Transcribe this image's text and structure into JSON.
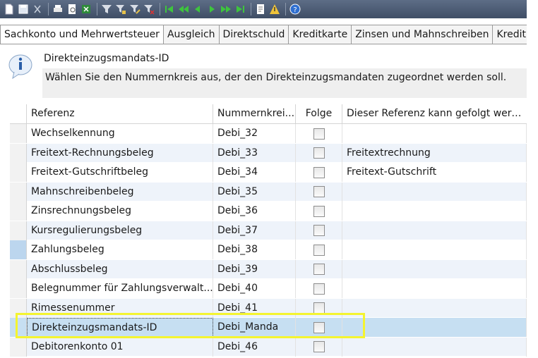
{
  "toolbar": {
    "icons": [
      "new-doc-icon",
      "save-icon",
      "cut-icon",
      "print-icon",
      "preview-icon",
      "export-icon",
      "filter-icon",
      "filter-add-icon",
      "filter-edit-icon",
      "filter-remove-icon",
      "first-icon",
      "prev-page-icon",
      "prev-icon",
      "next-icon",
      "next-page-icon",
      "last-icon",
      "notes-icon",
      "alert-icon",
      "help-icon"
    ],
    "bg_color": "#4a5a73"
  },
  "tabs": [
    {
      "label": "Sachkonto und Mehrwertsteuer"
    },
    {
      "label": "Ausgleich"
    },
    {
      "label": "Direktschuld"
    },
    {
      "label": "Kreditkarte"
    },
    {
      "label": "Zinsen und Mahnschreiben"
    },
    {
      "label": "Kredit"
    }
  ],
  "info": {
    "title": "Direkteinzugsmandats-ID",
    "description": "Wählen Sie den Nummernkreis aus, der den Direkteinzugsmandaten zugeordnet werden soll."
  },
  "grid": {
    "columns": {
      "referenz": "Referenz",
      "nummernkreis": "Nummernkrei...",
      "folge": "Folge",
      "dieser": "Dieser Referenz kann gefolgt werd..."
    },
    "rows": [
      {
        "referenz": "Wechselkennung",
        "nummernkreis": "Debi_32",
        "dieser": ""
      },
      {
        "referenz": "Freitext-Rechnungsbeleg",
        "nummernkreis": "Debi_33",
        "dieser": "Freitextrechnung"
      },
      {
        "referenz": "Freitext-Gutschriftbeleg",
        "nummernkreis": "Debi_34",
        "dieser": "Freitext-Gutschrift"
      },
      {
        "referenz": "Mahnschreibenbeleg",
        "nummernkreis": "Debi_35",
        "dieser": ""
      },
      {
        "referenz": "Zinsrechnungsbeleg",
        "nummernkreis": "Debi_36",
        "dieser": ""
      },
      {
        "referenz": "Kursregulierungsbeleg",
        "nummernkreis": "Debi_37",
        "dieser": ""
      },
      {
        "referenz": "Zahlungsbeleg",
        "nummernkreis": "Debi_38",
        "dieser": ""
      },
      {
        "referenz": "Abschlussbeleg",
        "nummernkreis": "Debi_39",
        "dieser": ""
      },
      {
        "referenz": "Belegnummer für Zahlungsverwalt...",
        "nummernkreis": "Debi_40",
        "dieser": ""
      },
      {
        "referenz": "Rimessenummer",
        "nummernkreis": "Debi_41",
        "dieser": ""
      },
      {
        "referenz": "Direkteinzugsmandats-ID",
        "nummernkreis": "Debi_Manda",
        "dieser": ""
      },
      {
        "referenz": "Debitorenkonto 01",
        "nummernkreis": "Debi_46",
        "dieser": ""
      }
    ]
  },
  "colors": {
    "selected_row": "#c6dff2",
    "alt_row": "#eef3fa",
    "highlight_box": "#f4f430"
  }
}
